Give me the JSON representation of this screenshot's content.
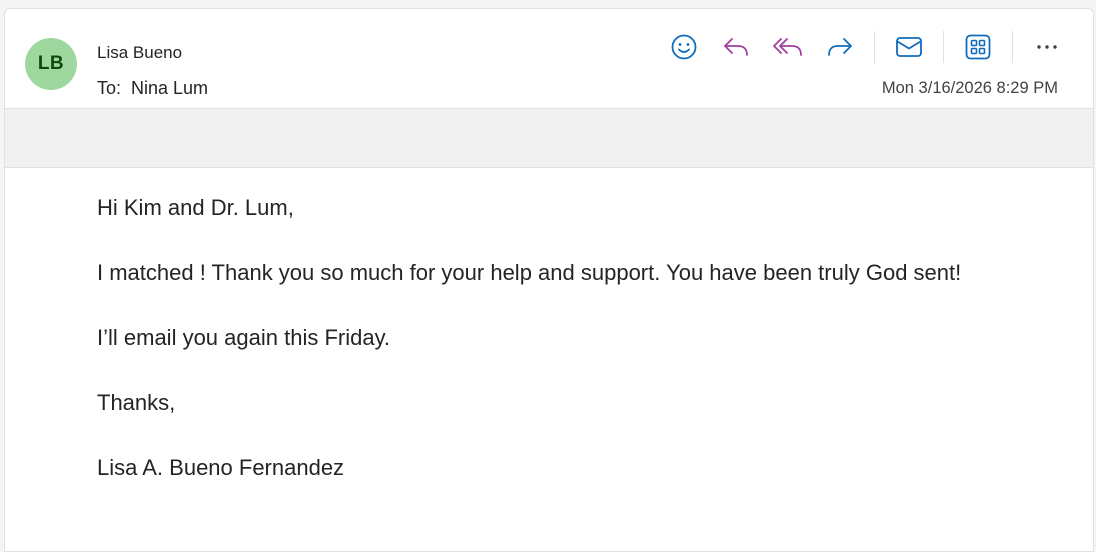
{
  "header": {
    "avatar_initials": "LB",
    "sender_name": "Lisa Bueno",
    "to_label": "To:",
    "to_name": "Nina Lum",
    "timestamp": "Mon 3/16/2026 8:29 PM"
  },
  "toolbar": {
    "buttons": [
      {
        "name": "react",
        "icon": "smiley-icon"
      },
      {
        "name": "reply",
        "icon": "reply-icon"
      },
      {
        "name": "reply-all",
        "icon": "reply-all-icon"
      },
      {
        "name": "forward",
        "icon": "forward-icon"
      },
      {
        "name": "mark-unread",
        "icon": "envelope-icon"
      },
      {
        "name": "apps",
        "icon": "apps-grid-icon"
      },
      {
        "name": "more",
        "icon": "more-icon"
      }
    ],
    "colors": {
      "react": "#0f6cbd",
      "reply": "#a33fa3",
      "reply_all": "#a33fa3",
      "forward": "#0f6cbd",
      "mail": "#0f6cbd",
      "apps": "#0f6cbd",
      "more": "#424242"
    }
  },
  "message": {
    "greeting": "Hi Kim and Dr. Lum,",
    "para1": "I matched ! Thank you so much for your help and support. You have been truly God sent!",
    "para2": "I’ll email you again this Friday.",
    "closing": "Thanks,",
    "signature": "Lisa A. Bueno Fernandez"
  },
  "avatar_color": "#9fd89f"
}
